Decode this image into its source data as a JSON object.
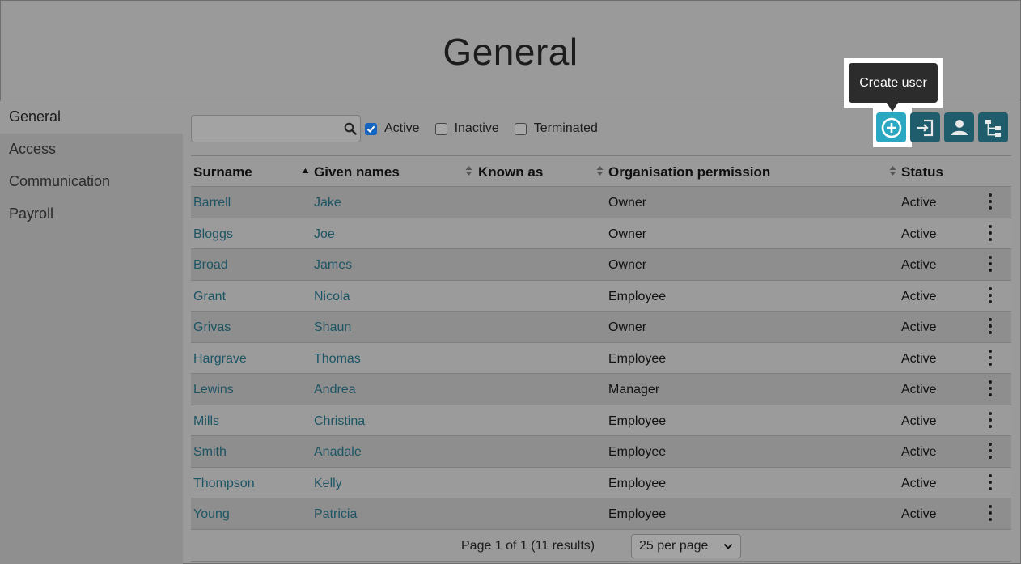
{
  "page": {
    "title": "General"
  },
  "sidebar": {
    "items": [
      {
        "label": "General",
        "active": true
      },
      {
        "label": "Access",
        "active": false
      },
      {
        "label": "Communication",
        "active": false
      },
      {
        "label": "Payroll",
        "active": false
      }
    ]
  },
  "search": {
    "value": "",
    "placeholder": ""
  },
  "filters": {
    "active": {
      "label": "Active",
      "checked": true
    },
    "inactive": {
      "label": "Inactive",
      "checked": false
    },
    "terminated": {
      "label": "Terminated",
      "checked": false
    }
  },
  "toolbar": {
    "tooltip": "Create user",
    "buttons": [
      "plus-circle-icon",
      "sign-in-icon",
      "user-icon",
      "org-tree-icon"
    ]
  },
  "table": {
    "headers": {
      "surname": "Surname",
      "given": "Given names",
      "known": "Known as",
      "permission": "Organisation permission",
      "status": "Status"
    },
    "rows": [
      {
        "surname": "Barrell",
        "given": "Jake",
        "known": "",
        "permission": "Owner",
        "status": "Active"
      },
      {
        "surname": "Bloggs",
        "given": "Joe",
        "known": "",
        "permission": "Owner",
        "status": "Active"
      },
      {
        "surname": "Broad",
        "given": "James",
        "known": "",
        "permission": "Owner",
        "status": "Active"
      },
      {
        "surname": "Grant",
        "given": "Nicola",
        "known": "",
        "permission": "Employee",
        "status": "Active"
      },
      {
        "surname": "Grivas",
        "given": "Shaun",
        "known": "",
        "permission": "Owner",
        "status": "Active"
      },
      {
        "surname": "Hargrave",
        "given": "Thomas",
        "known": "",
        "permission": "Employee",
        "status": "Active"
      },
      {
        "surname": "Lewins",
        "given": "Andrea",
        "known": "",
        "permission": "Manager",
        "status": "Active"
      },
      {
        "surname": "Mills",
        "given": "Christina",
        "known": "",
        "permission": "Employee",
        "status": "Active"
      },
      {
        "surname": "Smith",
        "given": "Anadale",
        "known": "",
        "permission": "Employee",
        "status": "Active"
      },
      {
        "surname": "Thompson",
        "given": "Kelly",
        "known": "",
        "permission": "Employee",
        "status": "Active"
      },
      {
        "surname": "Young",
        "given": "Patricia",
        "known": "",
        "permission": "Employee",
        "status": "Active"
      }
    ]
  },
  "pager": {
    "info": "Page 1 of 1 (11 results)",
    "per_page": "25 per page"
  },
  "colors": {
    "accent": "#1f5d6c",
    "highlight": "#2aa7c1",
    "link": "#1d5564",
    "checkbox": "#1565c0"
  }
}
